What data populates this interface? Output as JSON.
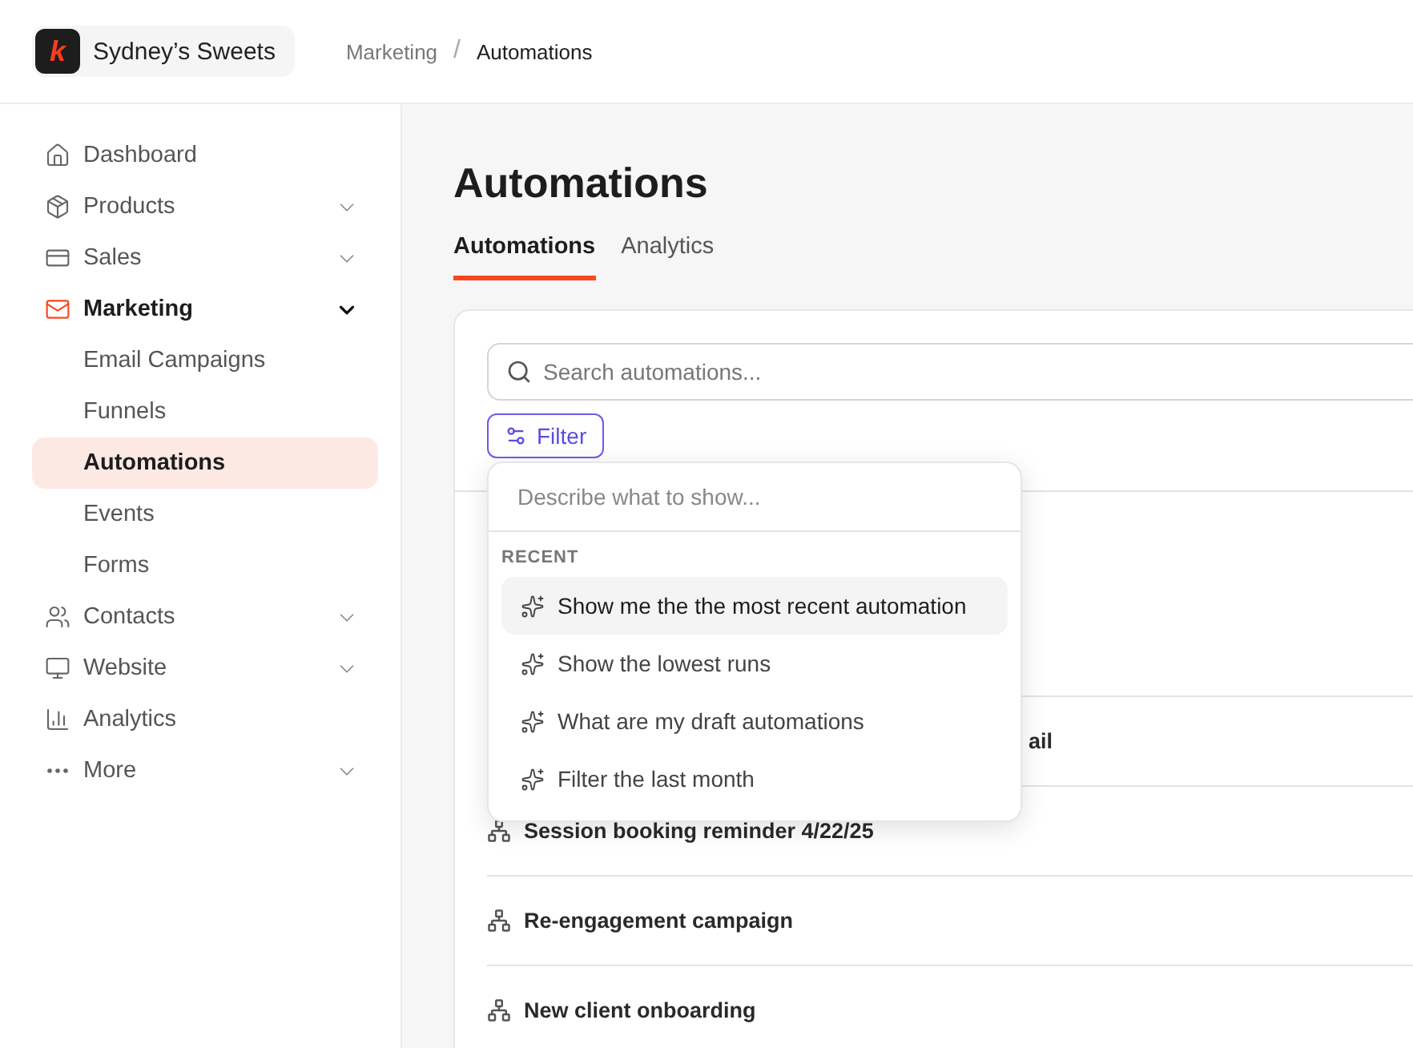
{
  "workspace": {
    "name": "Sydney’s Sweets",
    "logo": "k"
  },
  "breadcrumbs": [
    {
      "label": "Marketing",
      "current": false
    },
    {
      "label": "/",
      "kind": "separator"
    },
    {
      "label": "Automations",
      "current": true
    }
  ],
  "sidebar": {
    "items": [
      {
        "label": "Dashboard",
        "kind": "link",
        "selected": false
      },
      {
        "label": "Products",
        "kind": "group",
        "selected": false,
        "expanded": false
      },
      {
        "label": "Sales",
        "kind": "group",
        "selected": false,
        "expanded": false
      },
      {
        "label": "Marketing",
        "kind": "group",
        "selected": true,
        "expanded": true,
        "children": [
          {
            "label": "Email Campaigns",
            "selected": false
          },
          {
            "label": "Funnels",
            "selected": false
          },
          {
            "label": "Automations",
            "selected": true
          },
          {
            "label": "Events",
            "selected": false
          },
          {
            "label": "Forms",
            "selected": false
          }
        ]
      },
      {
        "label": "Contacts",
        "kind": "group",
        "selected": false,
        "expanded": false
      },
      {
        "label": "Website",
        "kind": "group",
        "selected": false,
        "expanded": false
      },
      {
        "label": "Analytics",
        "kind": "link",
        "selected": false
      },
      {
        "label": "More",
        "kind": "group",
        "selected": false,
        "expanded": false
      }
    ]
  },
  "page": {
    "title": "Automations",
    "tabs": [
      {
        "label": "Automations",
        "selected": true
      },
      {
        "label": "Analytics",
        "selected": false
      }
    ],
    "search": {
      "placeholder": "Search automations..."
    },
    "filter_button": "Filter",
    "rows": [
      {
        "name": "ail",
        "kind": "covered"
      },
      {
        "name": "Session booking reminder 4/22/25",
        "kind": "automation"
      },
      {
        "name": "Re-engagement campaign",
        "kind": "automation"
      },
      {
        "name": "New client onboarding",
        "kind": "automation"
      }
    ],
    "filter_menu": {
      "placeholder": "Describe what to show...",
      "section": "RECENT",
      "items": [
        {
          "label": "Show me the the most recent automation",
          "selected": true
        },
        {
          "label": "Show the lowest runs",
          "selected": false
        },
        {
          "label": "What are my draft automations",
          "selected": false
        },
        {
          "label": "Filter the last month",
          "selected": false
        }
      ]
    }
  }
}
